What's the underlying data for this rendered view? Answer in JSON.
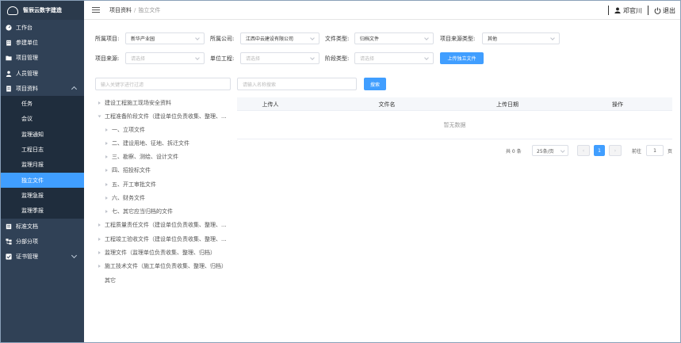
{
  "app": {
    "title": "智辰云数字建造"
  },
  "sidebar": {
    "items": [
      {
        "label": "工作台",
        "icon": "dashboard-icon"
      },
      {
        "label": "参建单位",
        "icon": "building-icon"
      },
      {
        "label": "项目管理",
        "icon": "folder-icon"
      },
      {
        "label": "人员管理",
        "icon": "person-icon"
      },
      {
        "label": "项目资料",
        "icon": "document-icon"
      }
    ],
    "sub_items": [
      "任务",
      "会议",
      "监理通知",
      "工程日志",
      "监理月报",
      "独立文件",
      "监理急报",
      "监理季报"
    ],
    "active_sub": "独立文件",
    "bottom_items": [
      {
        "label": "标准文档",
        "icon": "book-icon"
      },
      {
        "label": "分部分项",
        "icon": "hierarchy-icon"
      },
      {
        "label": "证书管理",
        "icon": "certificate-icon"
      }
    ]
  },
  "header": {
    "breadcrumb_parent": "项目资料",
    "breadcrumb_sep": "/",
    "breadcrumb_current": "独立文件",
    "username": "邓官川",
    "logout_label": "退出"
  },
  "filters": {
    "project_label": "所属项目:",
    "project_value": "新华产业园",
    "company_label": "所属公司:",
    "company_value": "江西中云建设有限公司",
    "filetype_label": "文件类型:",
    "filetype_value": "归档文件",
    "source_type_label": "项目来源类型:",
    "source_type_value": "其他",
    "source_label": "项目来源:",
    "source_placeholder": "请选择",
    "unit_label": "单位工程:",
    "unit_placeholder": "请选择",
    "stage_label": "阶段类型:",
    "stage_placeholder": "请选择",
    "upload_label": "上传独立文件"
  },
  "tree_filter_placeholder": "输入关键字进行过滤",
  "search": {
    "placeholder": "请输入名称搜索",
    "button": "搜索"
  },
  "tree": [
    "建设工程施工现场安全资料",
    "工程准备阶段文件（建设单位负责收集、整理、...",
    "一、立项文件",
    "二、建设用地、征地、拆迁文件",
    "三、勘察、测绘、设计文件",
    "四、招投标文件",
    "五、开工审批文件",
    "六、财务文件",
    "七、其它应当归档的文件",
    "工程质量责任文件（建设单位负责收集、整理、...",
    "工程竣工验收文件（建设单位负责收集、整理、...",
    "监理文件（监理单位负责收集、整理、归档）",
    "施工技术文件（施工单位负责收集、整理、归档）",
    "其它"
  ],
  "table": {
    "columns": [
      "上传人",
      "文件名",
      "上传日期",
      "操作"
    ],
    "empty_text": "暂无数据"
  },
  "pagination": {
    "total": "共 0 条",
    "page_size": "25条/页",
    "current_page": "1",
    "goto_label": "前往",
    "goto_value": "1",
    "page_suffix": "页"
  },
  "colors": {
    "sidebar_bg": "#304156",
    "accent": "#409eff"
  }
}
